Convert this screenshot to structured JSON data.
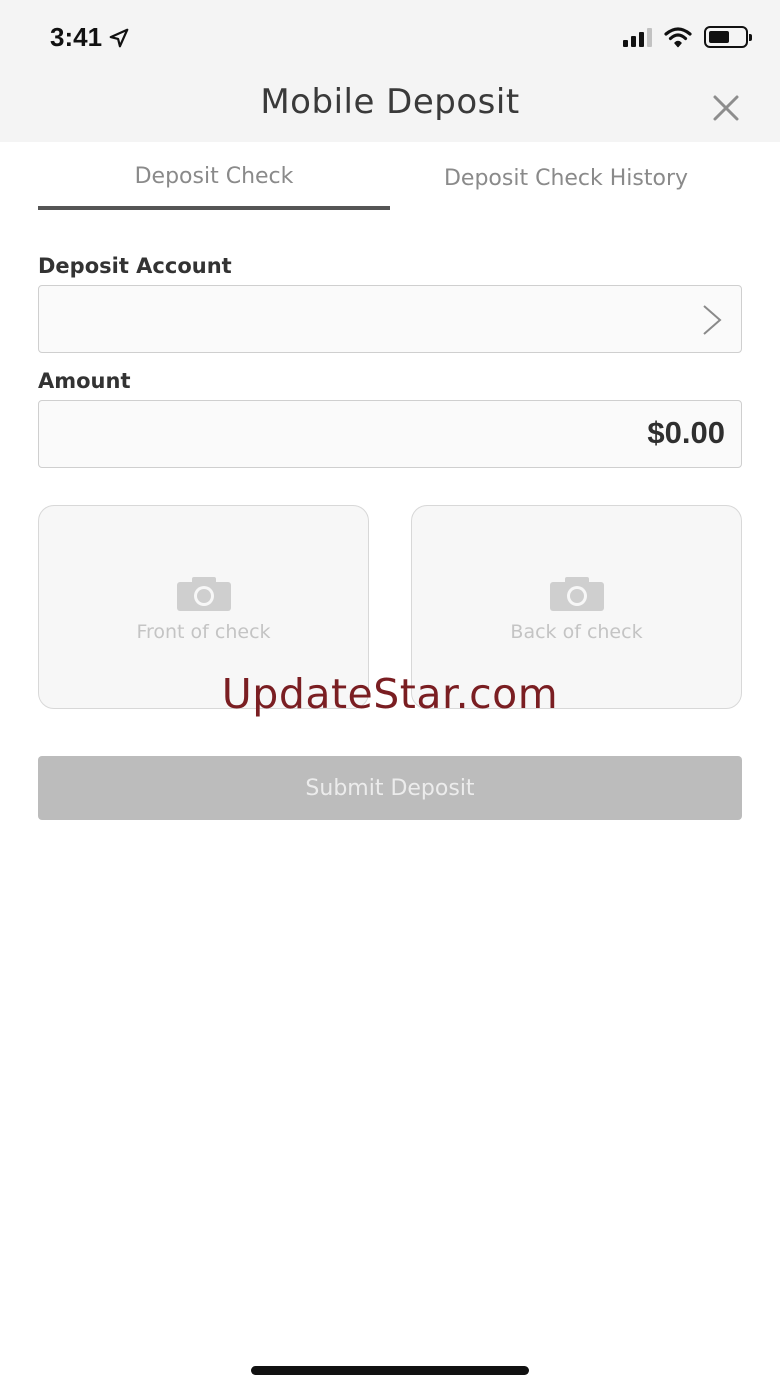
{
  "status_bar": {
    "time": "3:41",
    "signal_bars_active": 3,
    "signal_bars_total": 4,
    "battery_level": 0.5
  },
  "header": {
    "title": "Mobile Deposit"
  },
  "tabs": [
    {
      "label": "Deposit Check",
      "active": true
    },
    {
      "label": "Deposit Check History",
      "active": false
    }
  ],
  "form": {
    "deposit_account": {
      "label": "Deposit Account",
      "value": ""
    },
    "amount": {
      "label": "Amount",
      "value": "$0.00"
    }
  },
  "check_images": {
    "front": {
      "caption": "Front of check"
    },
    "back": {
      "caption": "Back of check"
    }
  },
  "watermark": "UpdateStar.com",
  "submit": {
    "label": "Submit Deposit",
    "enabled": false
  },
  "colors": {
    "header_bg": "#f4f4f4",
    "active_tab_underline": "#555555",
    "watermark": "#7a1e22",
    "submit_disabled": "#bcbcbc"
  }
}
